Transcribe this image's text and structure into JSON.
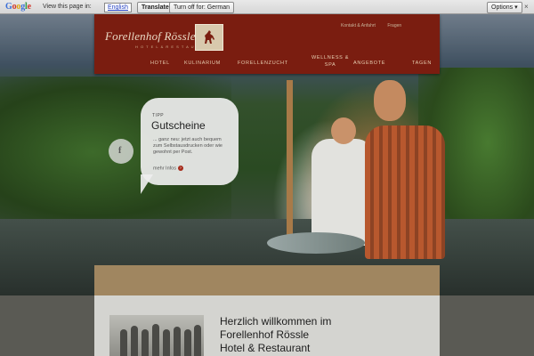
{
  "translate_bar": {
    "logo": "Google",
    "message": "View this page in:",
    "language": "English",
    "translate_label": "Translate",
    "turn_off_label": "Turn off for: German",
    "options_label": "Options ▾",
    "close_symbol": "×"
  },
  "header": {
    "brand": "Forellenhof Rössle",
    "brand_sub": "H O T E L  &  R E S T A U R A N T",
    "top_links": [
      "Kontakt & Anfahrt",
      "Fragen"
    ],
    "nav": [
      "HOTEL",
      "KULINARIUM",
      "FORELLENZUCHT",
      "WELLNESS &",
      "SPA",
      "ANGEBOTE",
      "TAGEN"
    ]
  },
  "bubble": {
    "tag": "TIPP",
    "title": "Gutscheine",
    "text": "... ganz neu: jetzt auch bequem zum Selbstausdrucken oder wie gewohnt per Post.",
    "more": "mehr Infos"
  },
  "social": {
    "icon": "facebook-icon",
    "glyph": "f"
  },
  "content": {
    "welcome_line1": "Herzlich willkommen im",
    "welcome_line2": "Forellenhof Rössle",
    "welcome_line3": "Hotel & Restaurant"
  },
  "colors": {
    "header_red": "#7a1d10",
    "strip_tan": "#a08660",
    "accent_red": "#a52a1a"
  }
}
